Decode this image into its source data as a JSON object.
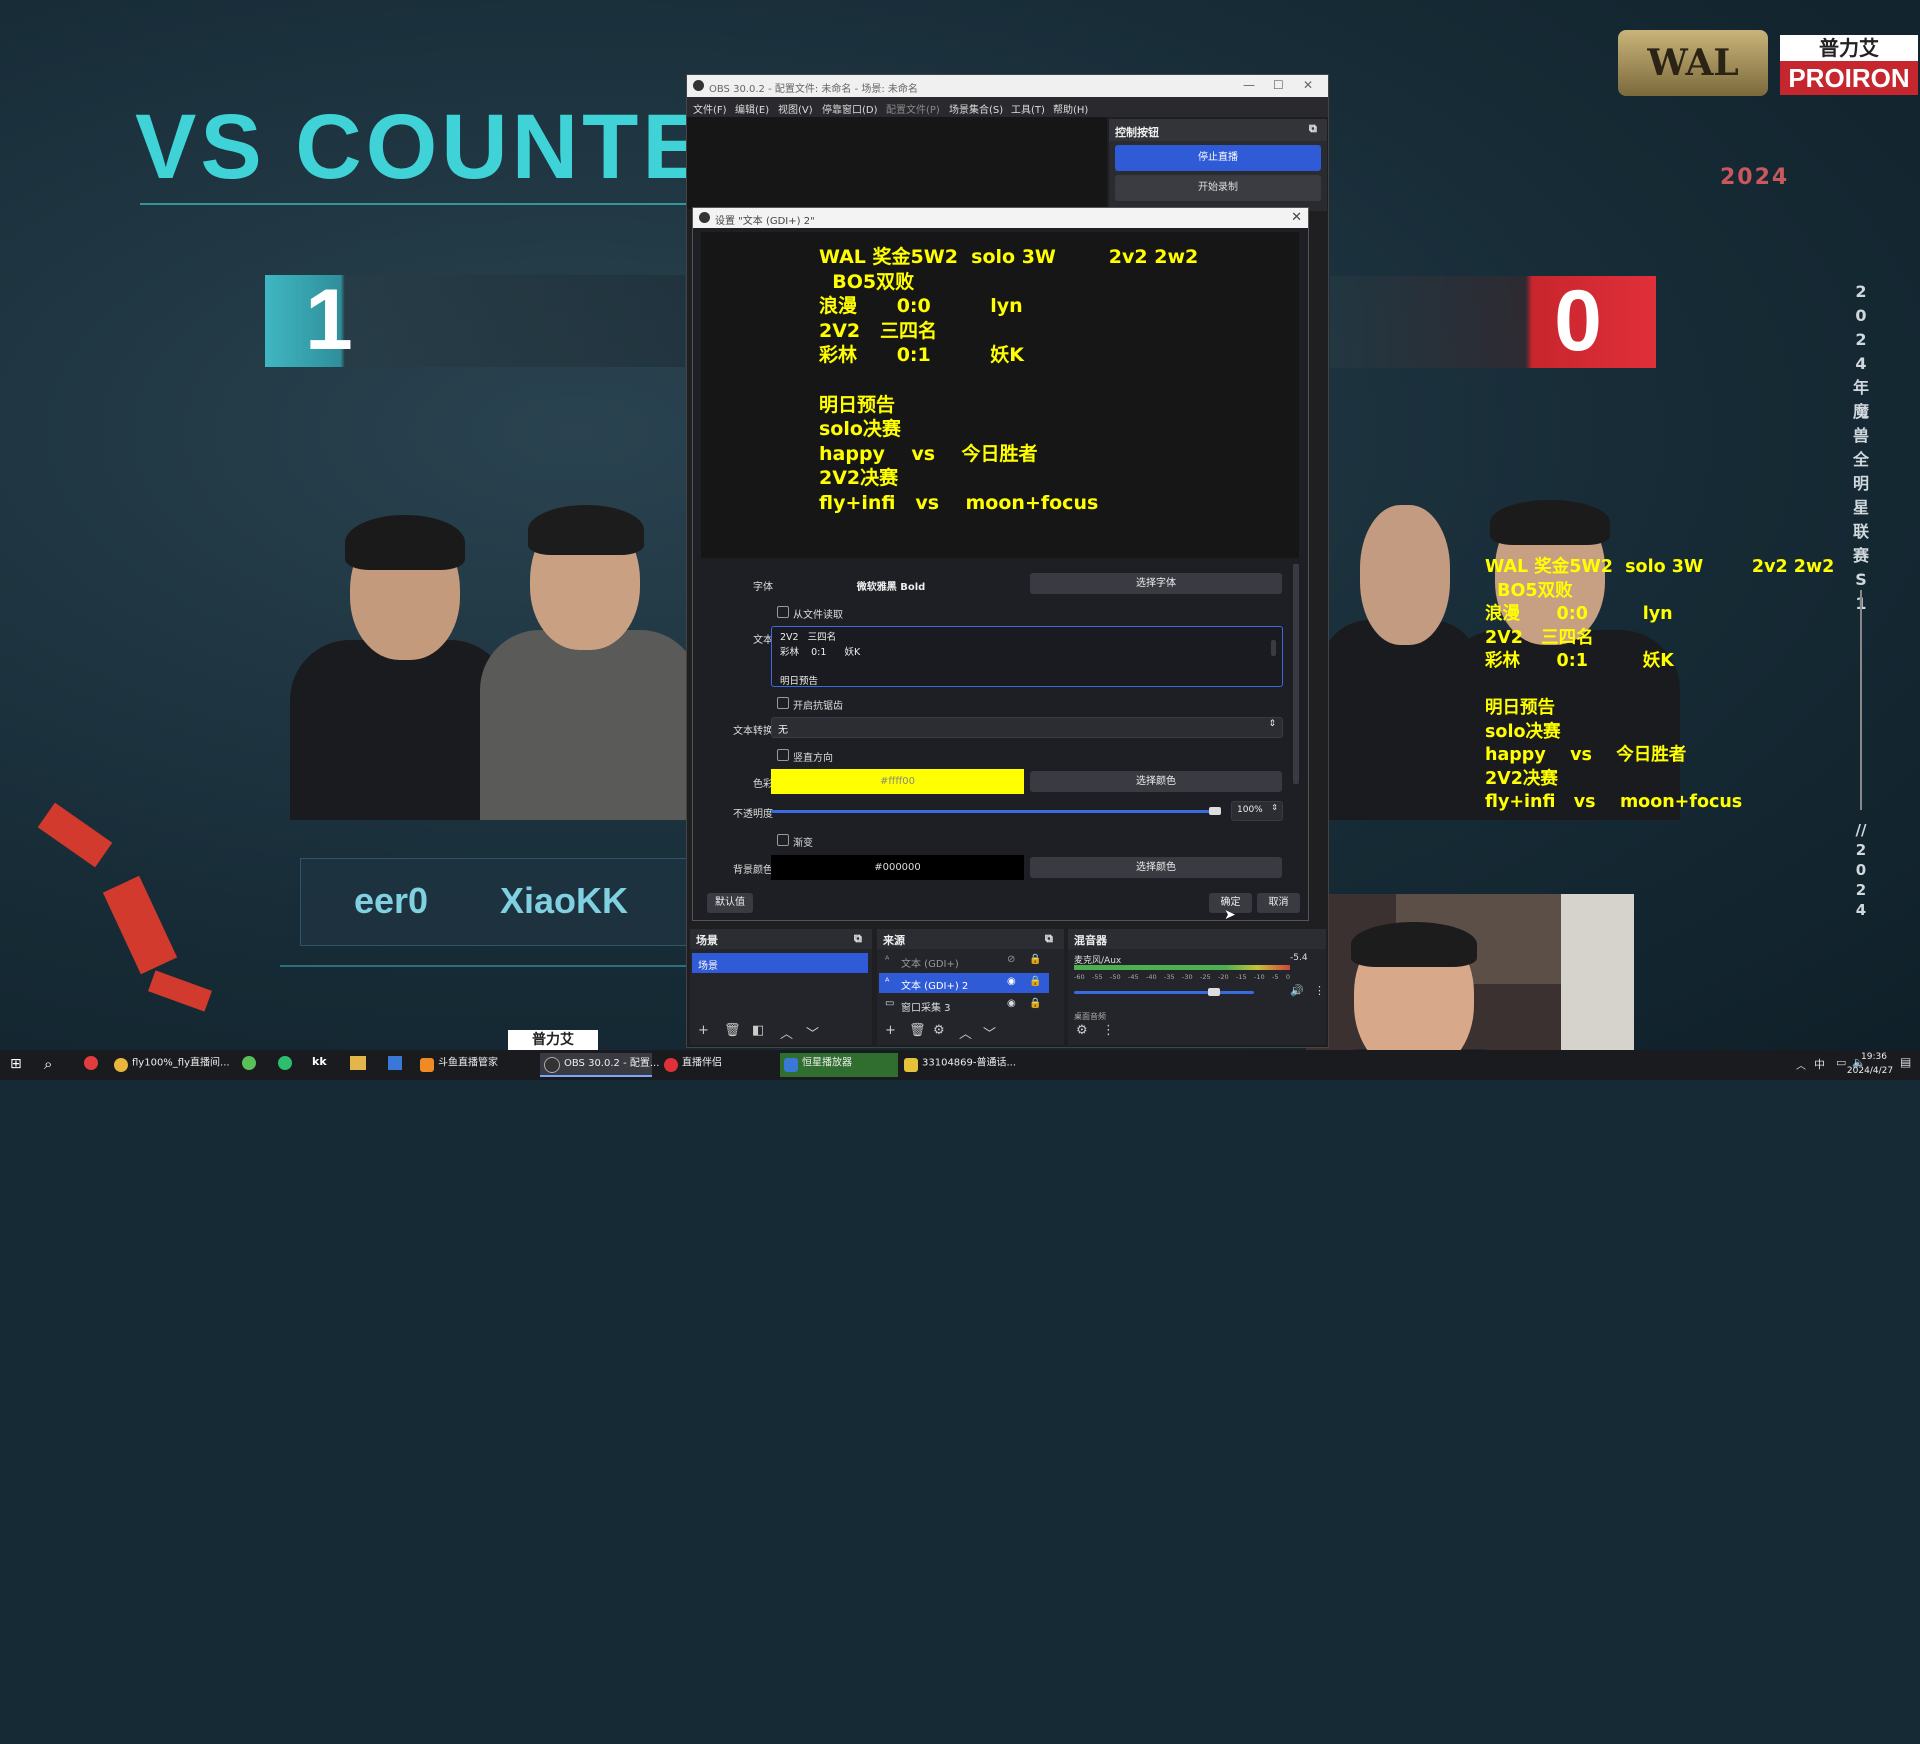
{
  "stream": {
    "vs_title": "VS COUNTEI",
    "score_left": "1",
    "score_right": "0",
    "player_left_1": "eer0",
    "player_left_2": "XiaoKK",
    "wal_logo": "WAL",
    "sponsor_cn": "普力艾",
    "sponsor_en": "PROIRON",
    "year": "2024",
    "vertical_text": "2024年魔兽全明星联赛S1",
    "vertical_text_2": "//2024",
    "overlay_text": "WAL 奖金5W2  solo 3W        2v2 2w2\n  BO5双败\n浪漫      0:0         lyn\n2V2   三四名\n彩林      0:1         妖K\n\n明日预告\nsolo决赛\nhappy    vs    今日胜者\n2V2决赛\nfly+infi   vs    moon+focus",
    "bottom_sponsor": "普力艾"
  },
  "obs": {
    "title": "OBS 30.0.2 - 配置文件: 未命名 - 场景: 未命名",
    "menu": [
      "文件(F)",
      "编辑(E)",
      "视图(V)",
      "停靠窗口(D)",
      "配置文件(P)",
      "场景集合(S)",
      "工具(T)",
      "帮助(H)"
    ],
    "controls": {
      "title": "控制按钮",
      "stop_stream": "停止直播",
      "start_record": "开始录制"
    },
    "dialog": {
      "title": "设置 \"文本 (GDI+) 2\"",
      "preview_text": "WAL 奖金5W2  solo 3W        2v2 2w2\n  BO5双败\n浪漫      0:0         lyn\n2V2   三四名\n彩林      0:1         妖K\n\n明日预告\nsolo决赛\nhappy    vs    今日胜者\n2V2决赛\nfly+infi   vs    moon+focus",
      "font_label": "字体",
      "font_value": "微软雅黑 Bold",
      "font_button": "选择字体",
      "read_from_file": "从文件读取",
      "text_label": "文本",
      "text_value": "2V2   三四名\n彩林    0:1      妖K\n\n明日预告",
      "antialias": "开启抗锯齿",
      "transform_label": "文本转换",
      "transform_value": "无",
      "vertical": "竖直方向",
      "color_label": "色彩",
      "color_value": "#ffff00",
      "color_button": "选择颜色",
      "opacity_label": "不透明度",
      "opacity_value": "100%",
      "opacity_fraction": 1.0,
      "gradient": "渐变",
      "bg_color_label": "背景颜色",
      "bg_color_value": "#000000",
      "bg_color_button": "选择颜色",
      "defaults_button": "默认值",
      "ok_button": "确定",
      "cancel_button": "取消"
    },
    "scenes": {
      "title": "场景",
      "items": [
        "场景"
      ]
    },
    "sources": {
      "title": "来源",
      "items": [
        "文本 (GDI+)",
        "文本 (GDI+) 2",
        "窗口采集 3"
      ]
    },
    "mixer": {
      "title": "混音器",
      "channel": "麦克风/Aux",
      "level": "-5.4",
      "ticks": [
        "-60",
        "-55",
        "-50",
        "-45",
        "-40",
        "-35",
        "-30",
        "-25",
        "-20",
        "-15",
        "-10",
        "-5",
        "0"
      ],
      "second_channel": "桌面音频"
    }
  },
  "taskbar": {
    "items": [
      "fly100%_fly直播间...",
      "斗鱼直播管家",
      "OBS 30.0.2 - 配置...",
      "直播伴侣",
      "恒星播放器",
      "33104869-普通话..."
    ],
    "ime": "中",
    "time": "19:36",
    "date": "2024/4/27"
  }
}
